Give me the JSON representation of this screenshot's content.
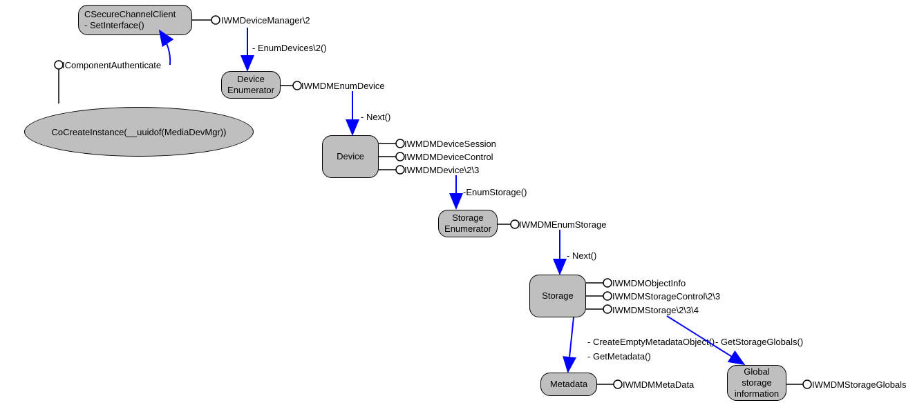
{
  "nodes": {
    "secureChannel": {
      "line1": "CSecureChannelClient",
      "line2": "- SetInterface()"
    },
    "cloud": "CoCreateInstance(__uuidof(MediaDevMgr))",
    "deviceEnum": {
      "line1": "Device",
      "line2": "Enumerator"
    },
    "device": "Device",
    "storageEnum": {
      "line1": "Storage",
      "line2": "Enumerator"
    },
    "storage": "Storage",
    "metadata": "Metadata",
    "globalStorage": {
      "line1": "Global",
      "line2": "storage",
      "line3": "information"
    }
  },
  "interfaces": {
    "devMgr": "IWMDeviceManager\\2",
    "compAuth": "IComponentAuthenticate",
    "enumDevice": "IWMDMEnumDevice",
    "devSession": "IWMDMDeviceSession",
    "devControl": "IWMDMDeviceControl",
    "devIface": "IWMDMDevice\\2\\3",
    "enumStorage": "IWMDMEnumStorage",
    "objInfo": "IWMDMObjectInfo",
    "storageCtrl": "IWMDMStorageControl\\2\\3",
    "storageIface": "IWMDMStorage\\2\\3\\4",
    "metaData": "IWMDMMetaData",
    "storageGlobals": "IWMDMStorageGlobals"
  },
  "methods": {
    "enumDevices": "- EnumDevices\\2()",
    "next1": "- Next()",
    "enumStorage": "-EnumStorage()",
    "next2": "- Next()",
    "createEmpty": "- CreateEmptyMetadataObject()",
    "getMeta": "- GetMetadata()",
    "getGlobals": "- GetStorageGlobals()"
  }
}
